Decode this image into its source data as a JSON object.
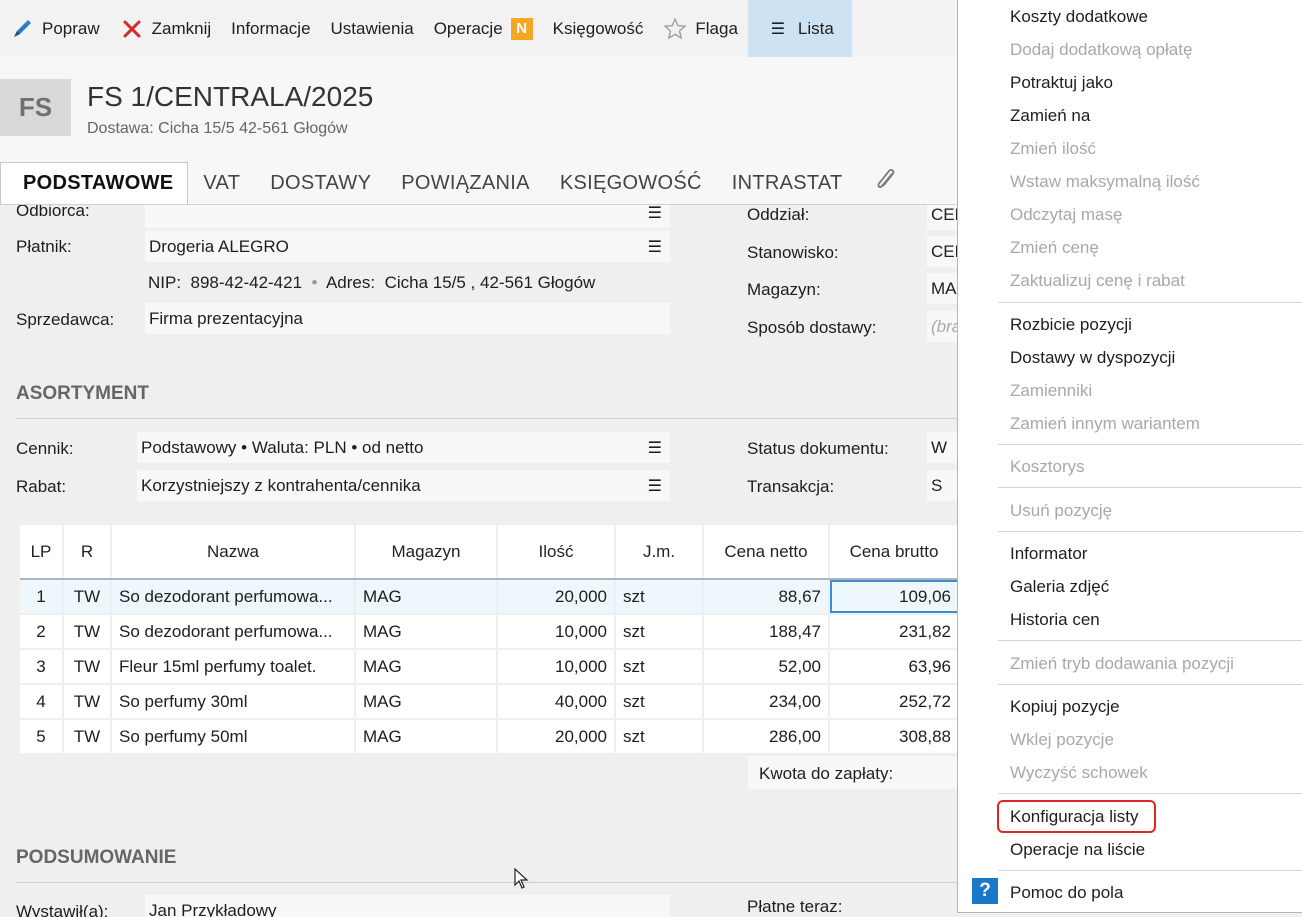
{
  "toolbar": {
    "edit": "Popraw",
    "close": "Zamknij",
    "info": "Informacje",
    "settings": "Ustawienia",
    "operations": "Operacje",
    "operations_badge": "N",
    "accounting": "Księgowość",
    "flag": "Flaga",
    "list": "Lista"
  },
  "header": {
    "badge": "FS",
    "title": "FS 1/CENTRALA/2025",
    "subtitle": "Dostawa: Cicha  15/5  42-561 Głogów"
  },
  "tabs": [
    "PODSTAWOWE",
    "VAT",
    "DOSTAWY",
    "POWIĄZANIA",
    "KSIĘGOWOŚĆ",
    "INTRASTAT"
  ],
  "form": {
    "odbiorca_label": "Odbiorca:",
    "platnik_label": "Płatnik:",
    "platnik_value": "Drogeria ALEGRO",
    "nip_label": "NIP:",
    "nip_value": "898-42-42-421",
    "adres_label": "Adres:",
    "adres_value": "Cicha  15/5 , 42-561 Głogów",
    "sprzedawca_label": "Sprzedawca:",
    "sprzedawca_value": "Firma prezentacyjna",
    "oddzial_label": "Oddział:",
    "oddzial_value": "CEN",
    "stanowisko_label": "Stanowisko:",
    "stanowisko_value": "CEN",
    "magazyn_label": "Magazyn:",
    "magazyn_value": "MA",
    "sposob_label": "Sposób dostawy:",
    "sposob_value": "(bra"
  },
  "asortyment": {
    "title": "ASORTYMENT",
    "cennik_label": "Cennik:",
    "cennik_value": "Podstawowy • Waluta: PLN • od netto",
    "rabat_label": "Rabat:",
    "rabat_value": "Korzystniejszy z kontrahenta/cennika",
    "status_label": "Status dokumentu:",
    "status_value": "W",
    "transakcja_label": "Transakcja:",
    "transakcja_value": "S"
  },
  "grid": {
    "columns": [
      "LP",
      "R",
      "Nazwa",
      "Magazyn",
      "Ilość",
      "J.m.",
      "Cena netto",
      "Cena brutto"
    ],
    "rows": [
      {
        "lp": "1",
        "r": "TW",
        "name": "So dezodorant perfumowa...",
        "mag": "MAG",
        "qty": "20,000",
        "jm": "szt",
        "net": "88,67",
        "gross": "109,06"
      },
      {
        "lp": "2",
        "r": "TW",
        "name": "So dezodorant perfumowa...",
        "mag": "MAG",
        "qty": "10,000",
        "jm": "szt",
        "net": "188,47",
        "gross": "231,82"
      },
      {
        "lp": "3",
        "r": "TW",
        "name": "Fleur 15ml perfumy toalet.",
        "mag": "MAG",
        "qty": "10,000",
        "jm": "szt",
        "net": "52,00",
        "gross": "63,96"
      },
      {
        "lp": "4",
        "r": "TW",
        "name": "So perfumy 30ml",
        "mag": "MAG",
        "qty": "40,000",
        "jm": "szt",
        "net": "234,00",
        "gross": "252,72"
      },
      {
        "lp": "5",
        "r": "TW",
        "name": "So perfumy 50ml",
        "mag": "MAG",
        "qty": "20,000",
        "jm": "szt",
        "net": "286,00",
        "gross": "308,88"
      }
    ],
    "total_label": "Kwota do zapłaty:"
  },
  "summary": {
    "title": "PODSUMOWANIE",
    "wystawil_label": "Wystawił(a):",
    "wystawil_value": "Jan Przykładowy",
    "platne_label": "Płatne teraz:"
  },
  "menu": {
    "koszty": "Koszty dodatkowe",
    "dodaj_oplate": "Dodaj dodatkową opłatę",
    "potraktuj": "Potraktuj jako",
    "zamien_na": "Zamień na",
    "zmien_ilosc": "Zmień ilość",
    "wstaw_max": "Wstaw maksymalną ilość",
    "odczytaj_mase": "Odczytaj masę",
    "zmien_cene": "Zmień cenę",
    "zaktualizuj": "Zaktualizuj cenę i rabat",
    "rozbicie": "Rozbicie pozycji",
    "dostawy_disp": "Dostawy w dyspozycji",
    "zamienniki": "Zamienniki",
    "zamien_wariant": "Zamień innym wariantem",
    "kosztorys": "Kosztorys",
    "usun": "Usuń pozycję",
    "informator": "Informator",
    "galeria": "Galeria zdjęć",
    "historia": "Historia cen",
    "zmien_tryb": "Zmień tryb dodawania pozycji",
    "kopiuj": "Kopiuj pozycje",
    "wklej": "Wklej pozycje",
    "wyczysc": "Wyczyść schowek",
    "konfiguracja": "Konfiguracja listy",
    "operacje_lista": "Operacje na liście",
    "pomoc": "Pomoc do pola",
    "help_icon": "?"
  }
}
